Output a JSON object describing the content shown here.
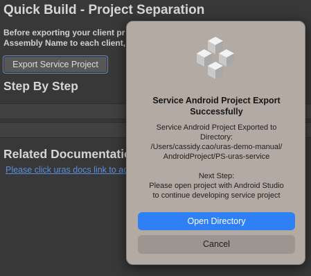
{
  "window": {
    "title": "Quick Build - Project Separation"
  },
  "main": {
    "description_line1": "Before exporting your client pr",
    "description_line2": "Assembly Name to each client,",
    "export_button_label": "Export Service Project",
    "step_section_title": "Step By Step",
    "docs_section_title": "Related Documentatio",
    "docs_link_text": "Please click uras docs link to ac"
  },
  "dialog": {
    "icon": "unity-cube-logo-icon",
    "title": "Service Android Project Export Successfully",
    "message_line1": "Service Android Project Exported to",
    "message_line2": "Directory:",
    "message_line3": "/Users/cassidy.cao/uras-demo-manual/",
    "message_line4": "AndroidProject/PS-uras-service",
    "next_step_heading": "Next Step:",
    "next_step_line1": "Please open project with Android Studio",
    "next_step_line2": "to continue developing service project",
    "primary_button_label": "Open Directory",
    "secondary_button_label": "Cancel"
  },
  "colors": {
    "background": "#383838",
    "dialog_background": "#b4aaa4",
    "primary_button": "#2f7ff5",
    "link": "#5a8fe0"
  }
}
